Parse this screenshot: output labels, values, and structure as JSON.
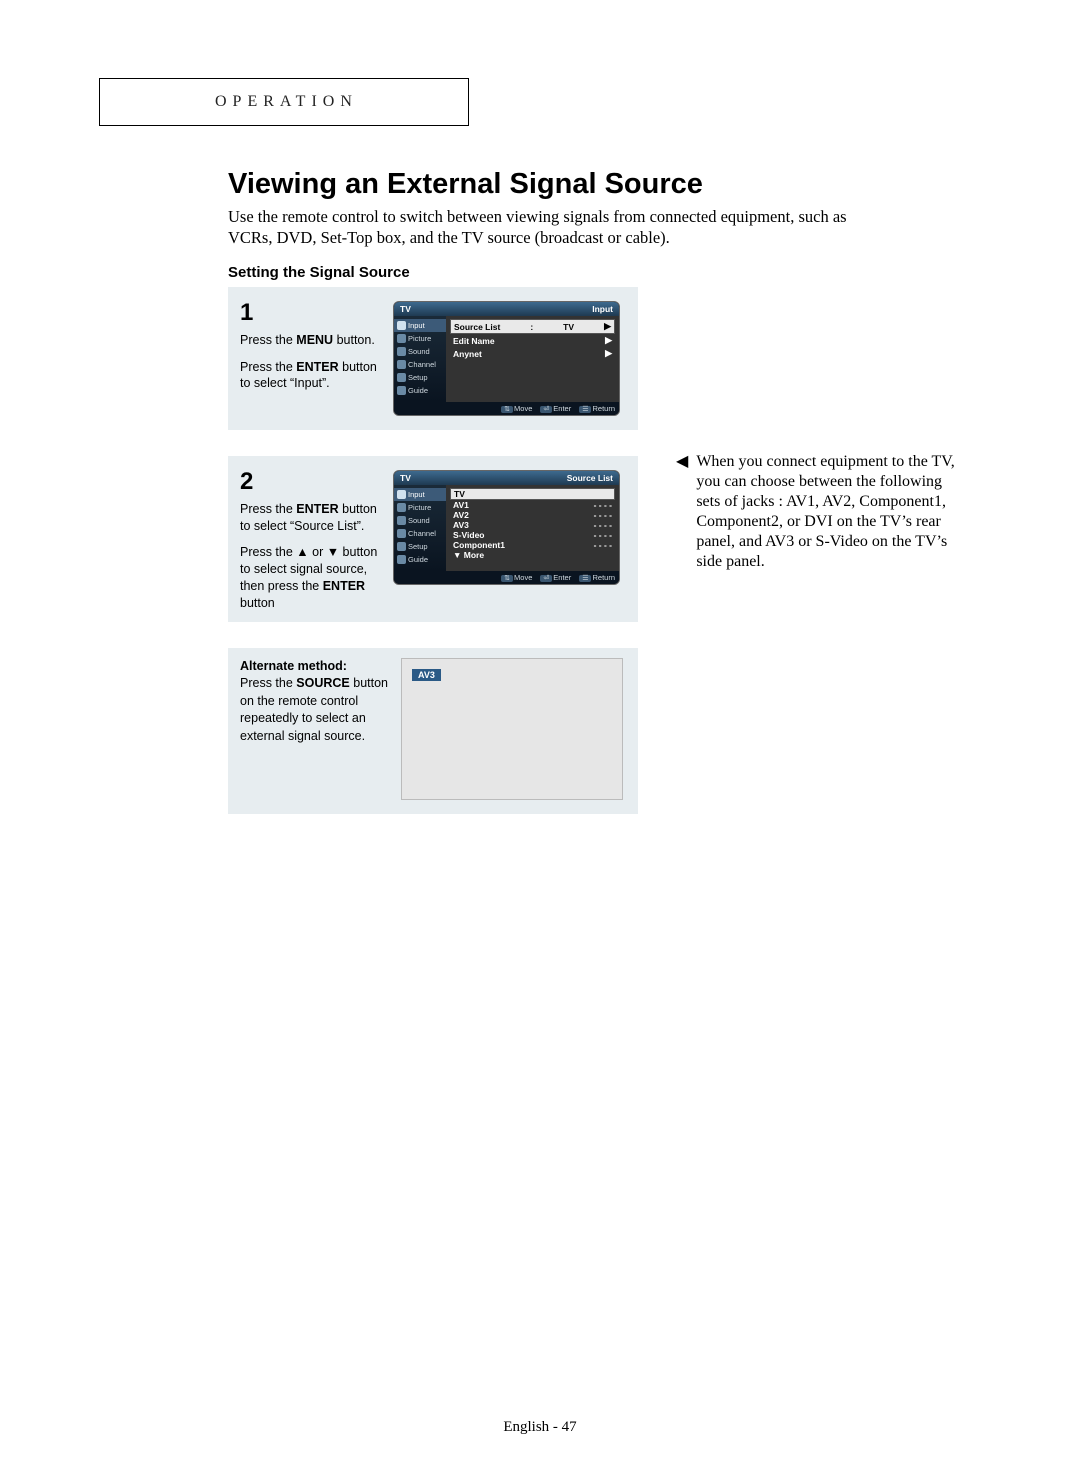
{
  "header": {
    "section": "OPERATION"
  },
  "title": "Viewing an External Signal Source",
  "intro": "Use the remote control to switch between viewing signals from connected equipment, such as VCRs, DVD, Set-Top box, and the TV source (broadcast or cable).",
  "subhead": "Setting the Signal Source",
  "step1": {
    "num": "1",
    "line1a": "Press the ",
    "line1b": "MENU",
    "line1c": " button.",
    "line2a": "Press the ",
    "line2b": "ENTER",
    "line2c": " button to select “Input”.",
    "osd": {
      "top_left": "TV",
      "top_right": "Input",
      "menu": [
        "Input",
        "Picture",
        "Sound",
        "Channel",
        "Setup",
        "Guide"
      ],
      "rows": [
        {
          "label": "Source List",
          "mid": ":",
          "value": "TV",
          "arrow": "▶",
          "sel": true
        },
        {
          "label": "Edit Name",
          "value": "",
          "arrow": "▶",
          "sel": false
        },
        {
          "label": "Anynet",
          "value": "",
          "arrow": "▶",
          "sel": false
        }
      ],
      "footer": {
        "move": "Move",
        "enter": "Enter",
        "ret": "Return"
      }
    }
  },
  "step2": {
    "num": "2",
    "line1a": "Press the ",
    "line1b": "ENTER",
    "line1c": " button to select “Source List”.",
    "line2a": "Press the ▲ or ▼ button to select signal source, then press the ",
    "line2b": "ENTER",
    "line2c": " button",
    "osd": {
      "top_left": "TV",
      "top_right": "Source List",
      "menu": [
        "Input",
        "Picture",
        "Sound",
        "Channel",
        "Setup",
        "Guide"
      ],
      "items": [
        {
          "label": "TV",
          "val": "",
          "sel": true
        },
        {
          "label": "AV1",
          "val": "- - - -"
        },
        {
          "label": "AV2",
          "val": "- - - -"
        },
        {
          "label": "AV3",
          "val": "- - - -"
        },
        {
          "label": "S-Video",
          "val": "- - - -"
        },
        {
          "label": "Component1",
          "val": "- - - -"
        },
        {
          "label": "▼ More",
          "val": ""
        }
      ],
      "footer": {
        "move": "Move",
        "enter": "Enter",
        "ret": "Return"
      }
    }
  },
  "alt": {
    "heading": "Alternate method:",
    "body_a": "Press the ",
    "body_b": "SOURCE",
    "body_c": " button on the remote control repeatedly to select an external signal source.",
    "tag": "AV3"
  },
  "sidenote": {
    "marker": "◀",
    "text": "When you connect equipment to the TV, you can choose between the following sets of jacks : AV1, AV2, Component1, Component2, or DVI on the TV’s rear panel, and AV3 or S-Video on the TV’s side panel."
  },
  "footer": "English - 47",
  "icons": {
    "updown": "⇅",
    "enter": "⏎",
    "ret": "☰"
  }
}
